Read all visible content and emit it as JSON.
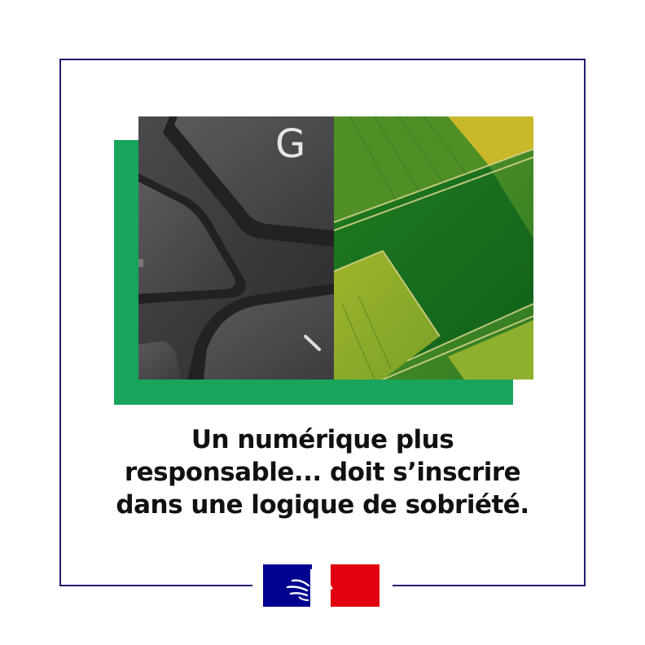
{
  "headline": {
    "line1": "Un numérique plus",
    "line2": "responsable... doit s’inscrire",
    "line3": "dans une logique de sobriété."
  },
  "photo": {
    "keyboard_key_letter": "G"
  },
  "colors": {
    "frame": "#1f1f6e",
    "accent_block": "#18a55b",
    "flag_blue": "#000091",
    "flag_red": "#e1000f"
  },
  "logo": {
    "icon": "marianne-logo-icon"
  }
}
